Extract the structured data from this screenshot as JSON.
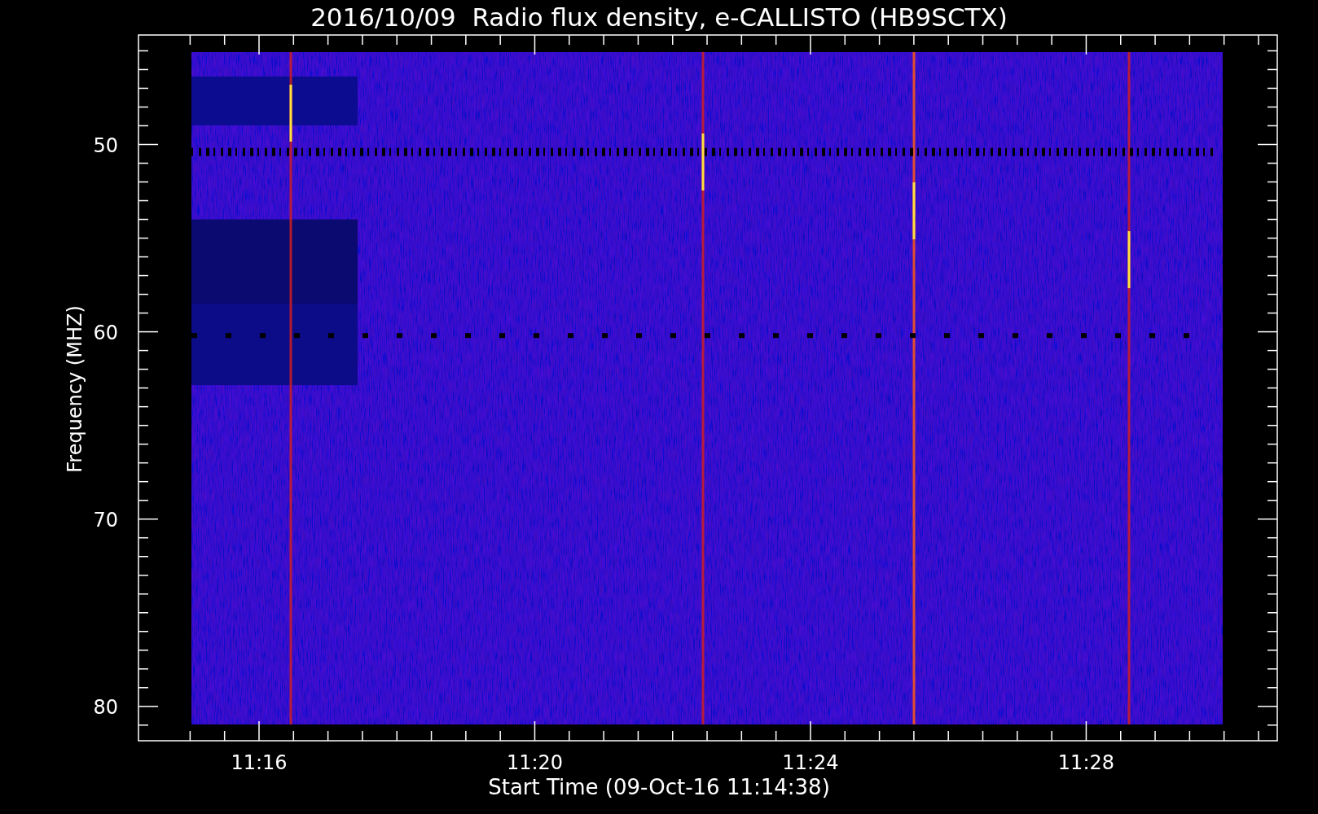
{
  "title": "2016/10/09  Radio flux density, e-CALLISTO (HB9SCTX)",
  "y_axis": {
    "label": "Frequency (MHZ)",
    "ticks": [
      "50",
      "60",
      "70",
      "80"
    ]
  },
  "x_axis": {
    "label": "Start Time (09-Oct-16 11:14:38)",
    "ticks": [
      "11:16",
      "11:20",
      "11:24",
      "11:28"
    ]
  }
}
